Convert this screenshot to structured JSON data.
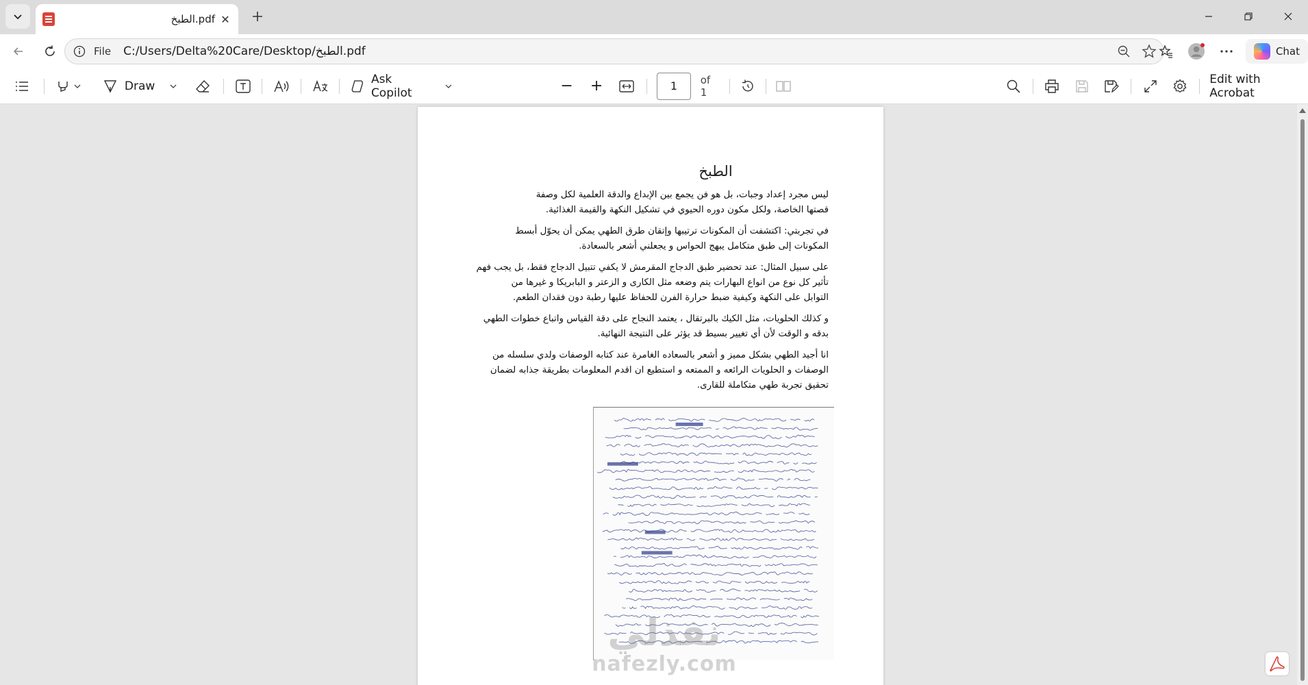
{
  "browser": {
    "tab": {
      "title": "الطبخ.pdf",
      "close_glyph": "✕"
    },
    "new_tab_glyph": "+",
    "window_controls": [
      "minimize",
      "restore",
      "close"
    ]
  },
  "address_bar": {
    "scheme_label": "File",
    "url": "C:/Users/Delta%20Care/Desktop/الطبخ.pdf",
    "chat_label": "Chat"
  },
  "pdf_toolbar": {
    "draw_label": "Draw",
    "ask_copilot_label": "Ask Copilot",
    "page_current": "1",
    "page_total_label": "of 1",
    "edit_acrobat_label": "Edit with Acrobat",
    "zoom_out_glyph": "−",
    "zoom_in_glyph": "+"
  },
  "document": {
    "title": "الطبخ",
    "paragraphs": [
      {
        "lines": [
          "ليس مجرد إعداد وجبات، بل هو فن يجمع بين الإبداع والدقة العلمية  لكل وصفة",
          "قصتها الخاصة، ولكل مكون دوره الحيوي في تشكيل النكهة والقيمة الغذائية."
        ]
      },
      {
        "lines": [
          "في تجربتي: اكتشفت أن المكونات  ترتيبها  وإتقان طرق الطهي يمكن أن يحوّل أبسط",
          "المكونات إلى طبق متكامل يبهج الحواس و يجعلني أشعر بالسعادة."
        ]
      },
      {
        "lines": [
          "على سبيل المثال: عند تحضير طبق الدجاج المقرمش لا يكفي تتبيل الدجاج فقط، بل يجب فهم",
          "تأثير كل نوع من انواع البهارات يتم وضعه مثل الكارى و الزعتر و البابريكا و غيرها من",
          "التوابل على النكهة وكيفية ضبط حرارة الفرن للحفاظ عليها رطبة دون فقدان الطعم."
        ]
      },
      {
        "lines": [
          "و كذلك  الحلويات، مثل الكيك بالبرتقال ، يعتمد النجاح على دقة القياس واتباع خطوات الطهي",
          "بدقه و الوقت  لأن أي تغيير بسيط قد يؤثر على النتيجة النهائية."
        ]
      },
      {
        "lines": [
          "انا أجيد الطهي بشكل مميز و أشعر بالسعاده الغامرة عند كتابه الوصفات ولدي سلسله من",
          "الوصفات و الحلويات الرائعه و الممتعه و استطيع ان اقدم المعلومات بطريقة جذابه لضمان",
          "تحقيق تجربة طهي متكاملة للقارى."
        ]
      }
    ],
    "watermark": {
      "arabic": "نفذلي",
      "latin": "nafezly.com"
    }
  },
  "colors": {
    "titlebar_bg": "#dcdcdc",
    "toolbar_bg": "#ffffff",
    "viewer_bg": "#e6e6e6",
    "pdf_red": "#d9443a",
    "ink_blue": "#2b3a8a"
  },
  "icons": [
    "tab-list-icon",
    "pdf-favicon-icon",
    "close-icon",
    "plus-icon",
    "minimize-icon",
    "restore-icon",
    "window-close-icon",
    "back-icon",
    "refresh-icon",
    "info-icon",
    "zoom-icon",
    "star-icon",
    "favorites-icon",
    "profile-icon",
    "more-icon",
    "copilot-icon",
    "contents-icon",
    "highlight-icon",
    "draw-icon",
    "eraser-icon",
    "text-box-icon",
    "read-aloud-icon",
    "translate-icon",
    "minus-icon",
    "fit-page-icon",
    "rotate-icon",
    "two-page-icon",
    "search-icon",
    "print-icon",
    "save-icon",
    "save-as-icon",
    "fullscreen-icon",
    "settings-icon",
    "acrobat-icon"
  ]
}
